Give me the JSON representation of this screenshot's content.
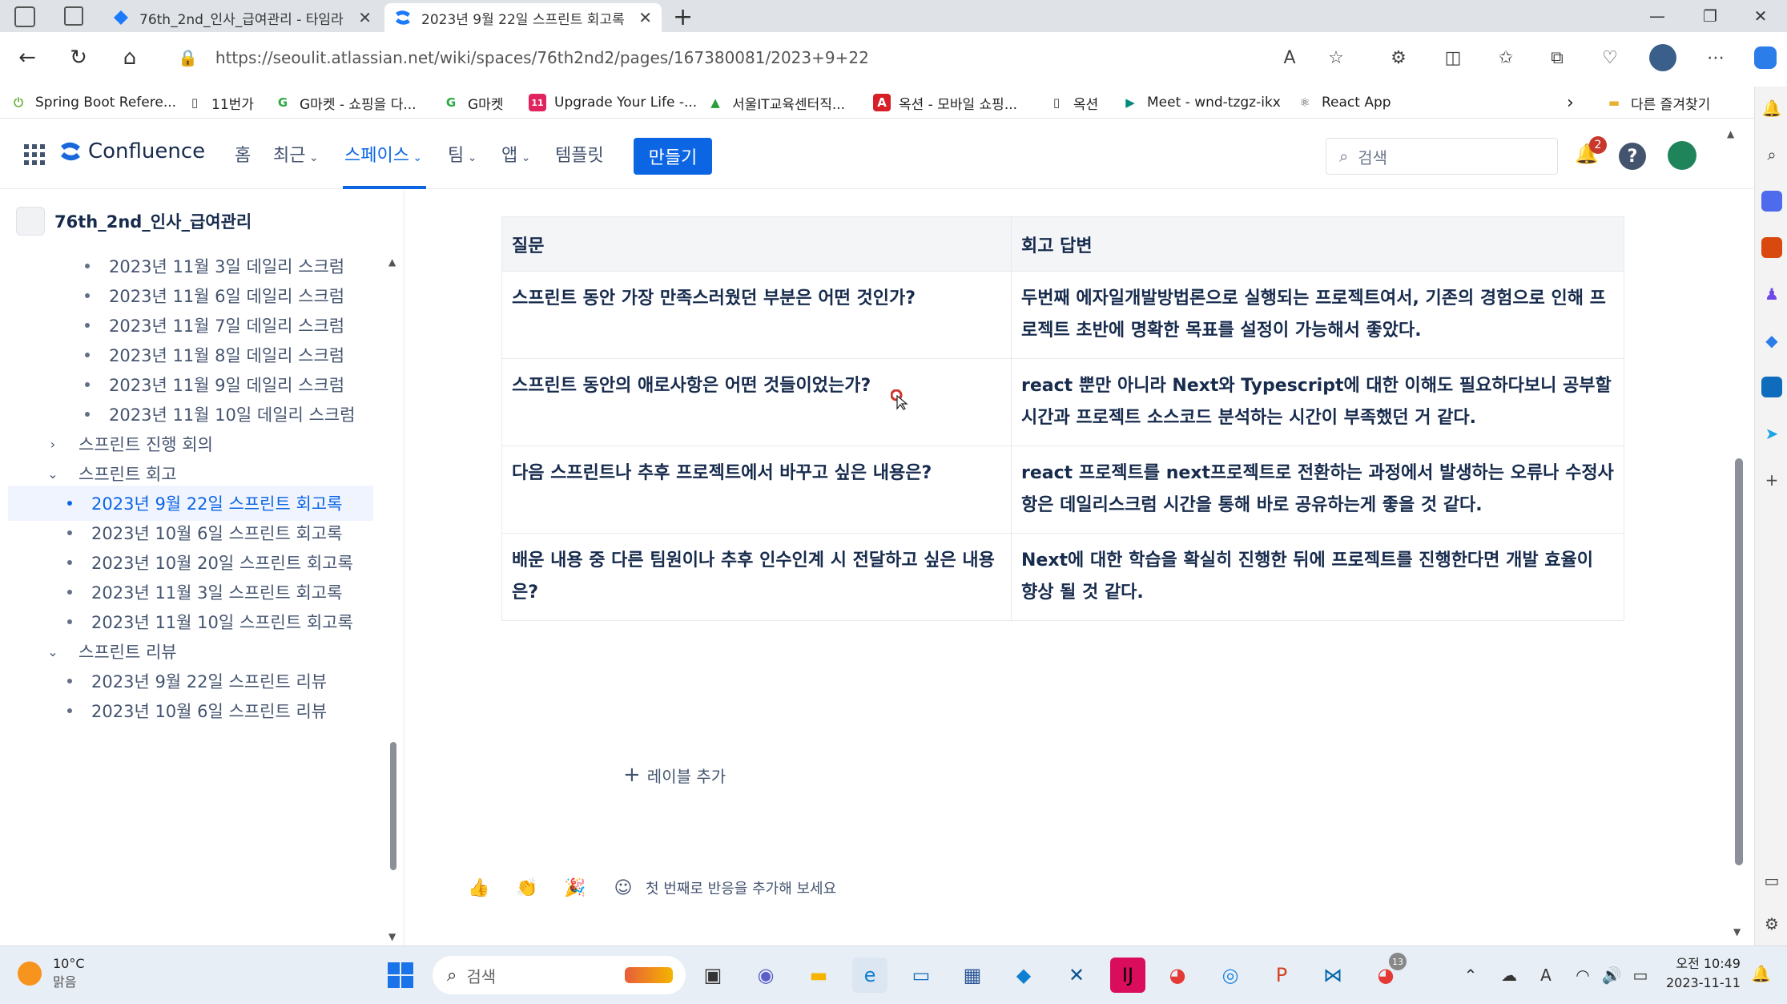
{
  "browser": {
    "tabs": [
      {
        "title": "76th_2nd_인사_급여관리 - 타임라",
        "active": false
      },
      {
        "title": "2023년 9월 22일 스프린트 회고록",
        "active": true
      }
    ],
    "new_tab": "+",
    "url": "https://seoulit.atlassian.net/wiki/spaces/76th2nd2/pages/167380081/2023+9+22",
    "bookmarks": [
      "Spring Boot Refere...",
      "11번가",
      "G마켓 - 쇼핑을 다...",
      "G마켓",
      "Upgrade Your Life -...",
      "서울IT교육센터직...",
      "옥션 - 모바일 쇼핑...",
      "옥션",
      "Meet - wnd-tzgz-ikx",
      "React App"
    ],
    "bookmarks_more": "다른 즐겨찾기"
  },
  "confluence": {
    "logo": "Confluence",
    "nav": [
      "홈",
      "최근",
      "스페이스",
      "팀",
      "앱",
      "템플릿"
    ],
    "create_label": "만들기",
    "search_placeholder": "검색",
    "notification_count": "2"
  },
  "sidebar": {
    "space_title": "76th_2nd_인사_급여관리",
    "items": [
      {
        "label": "2023년 11월 3일 데일리 스크럼",
        "type": "leaf",
        "level": 2
      },
      {
        "label": "2023년 11월 6일 데일리 스크럼",
        "type": "leaf",
        "level": 2
      },
      {
        "label": "2023년 11월 7일 데일리 스크럼",
        "type": "leaf",
        "level": 2
      },
      {
        "label": "2023년 11월 8일 데일리 스크럼",
        "type": "leaf",
        "level": 2
      },
      {
        "label": "2023년 11월 9일 데일리 스크럼",
        "type": "leaf",
        "level": 2
      },
      {
        "label": "2023년 11월 10일 데일리 스크럼",
        "type": "leaf",
        "level": 2
      },
      {
        "label": "스프린트 진행 회의",
        "type": "collapsed",
        "level": 1
      },
      {
        "label": "스프린트 회고",
        "type": "expanded",
        "level": 1
      },
      {
        "label": "2023년 9월 22일 스프린트 회고록",
        "type": "leaf",
        "level": 1,
        "selected": true
      },
      {
        "label": "2023년 10월 6일 스프린트 회고록",
        "type": "leaf",
        "level": 1
      },
      {
        "label": "2023년 10월 20일 스프린트 회고록",
        "type": "leaf",
        "level": 1
      },
      {
        "label": "2023년 11월 3일 스프린트 회고록",
        "type": "leaf",
        "level": 1
      },
      {
        "label": "2023년 11월 10일 스프린트 회고록",
        "type": "leaf",
        "level": 1
      },
      {
        "label": "스프린트 리뷰",
        "type": "expanded",
        "level": 1
      },
      {
        "label": "2023년 9월 22일 스프린트 리뷰",
        "type": "leaf",
        "level": 1
      },
      {
        "label": "2023년 10월 6일 스프린트 리뷰",
        "type": "leaf",
        "level": 1
      }
    ]
  },
  "page": {
    "table": {
      "headers": [
        "질문",
        "회고 답변"
      ],
      "rows": [
        [
          "스프린트 동안 가장 만족스러웠던 부분은 어떤 것인가?",
          "두번째 에자일개발방법론으로 실행되는 프로젝트여서, 기존의 경험으로 인해 프로젝트 초반에 명확한 목표를 설정이 가능해서 좋았다."
        ],
        [
          "스프린트 동안의 애로사항은 어떤 것들이었는가?",
          "react 뿐만 아니라 Next와 Typescript에 대한 이해도 필요하다보니 공부할 시간과 프로젝트 소스코드 분석하는 시간이 부족했던 거 같다."
        ],
        [
          "다음 스프린트나 추후 프로젝트에서 바꾸고 싶은 내용은?",
          "react 프로젝트를 next프로젝트로 전환하는 과정에서 발생하는 오류나 수정사항은 데일리스크럼 시간을 통해 바로 공유하는게 좋을 것 같다."
        ],
        [
          "배운 내용 중 다른 팀원이나 추후 인수인계 시 전달하고 싶은 내용은?",
          "Next에 대한 학습을 확실히 진행한 뒤에 프로젝트를 진행한다면 개발 효율이 향상 될 것 같다."
        ]
      ]
    },
    "label_add": "레이블 추가",
    "reaction_prompt": "첫 번째로 반응을 추가해 보세요"
  },
  "taskbar": {
    "weather_temp": "10°C",
    "weather_desc": "맑음",
    "search_placeholder": "검색",
    "time": "오전 10:49",
    "date": "2023-11-11",
    "chrome_badge": "13"
  },
  "colors": {
    "accent": "#0c66e4",
    "tab_bar": "#dfe3e8",
    "taskbar": "#e8eef5"
  }
}
